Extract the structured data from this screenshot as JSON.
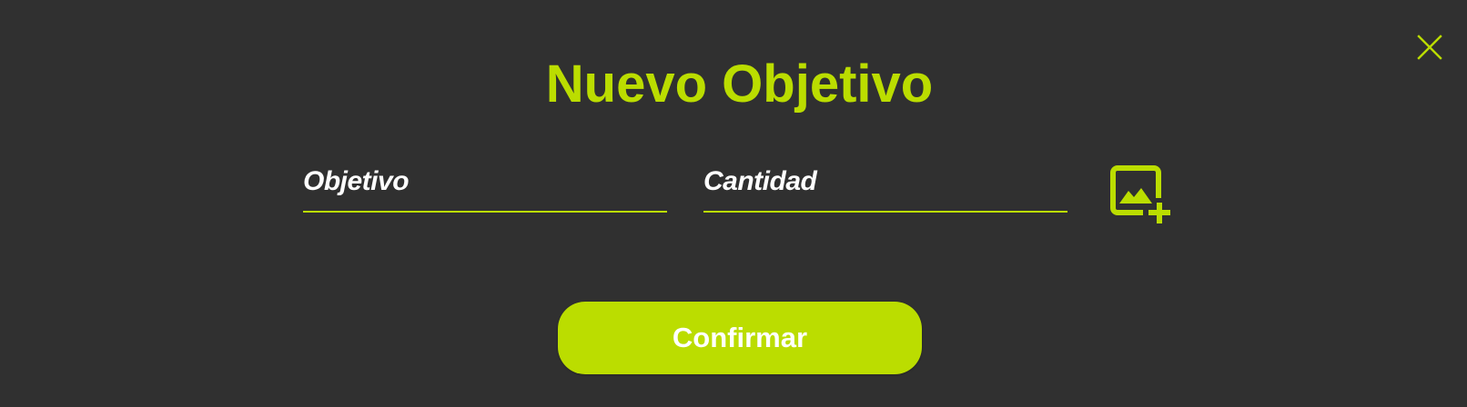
{
  "modal": {
    "title": "Nuevo Objetivo",
    "close_icon": "close-icon",
    "fields": {
      "objetivo": {
        "value": "",
        "placeholder": "Objetivo"
      },
      "cantidad": {
        "value": "",
        "placeholder": "Cantidad"
      }
    },
    "add_image_icon": "add-image-icon",
    "confirm_label": "Confirmar"
  },
  "colors": {
    "background": "#303030",
    "accent": "#bbdd00",
    "text": "#ffffff"
  }
}
